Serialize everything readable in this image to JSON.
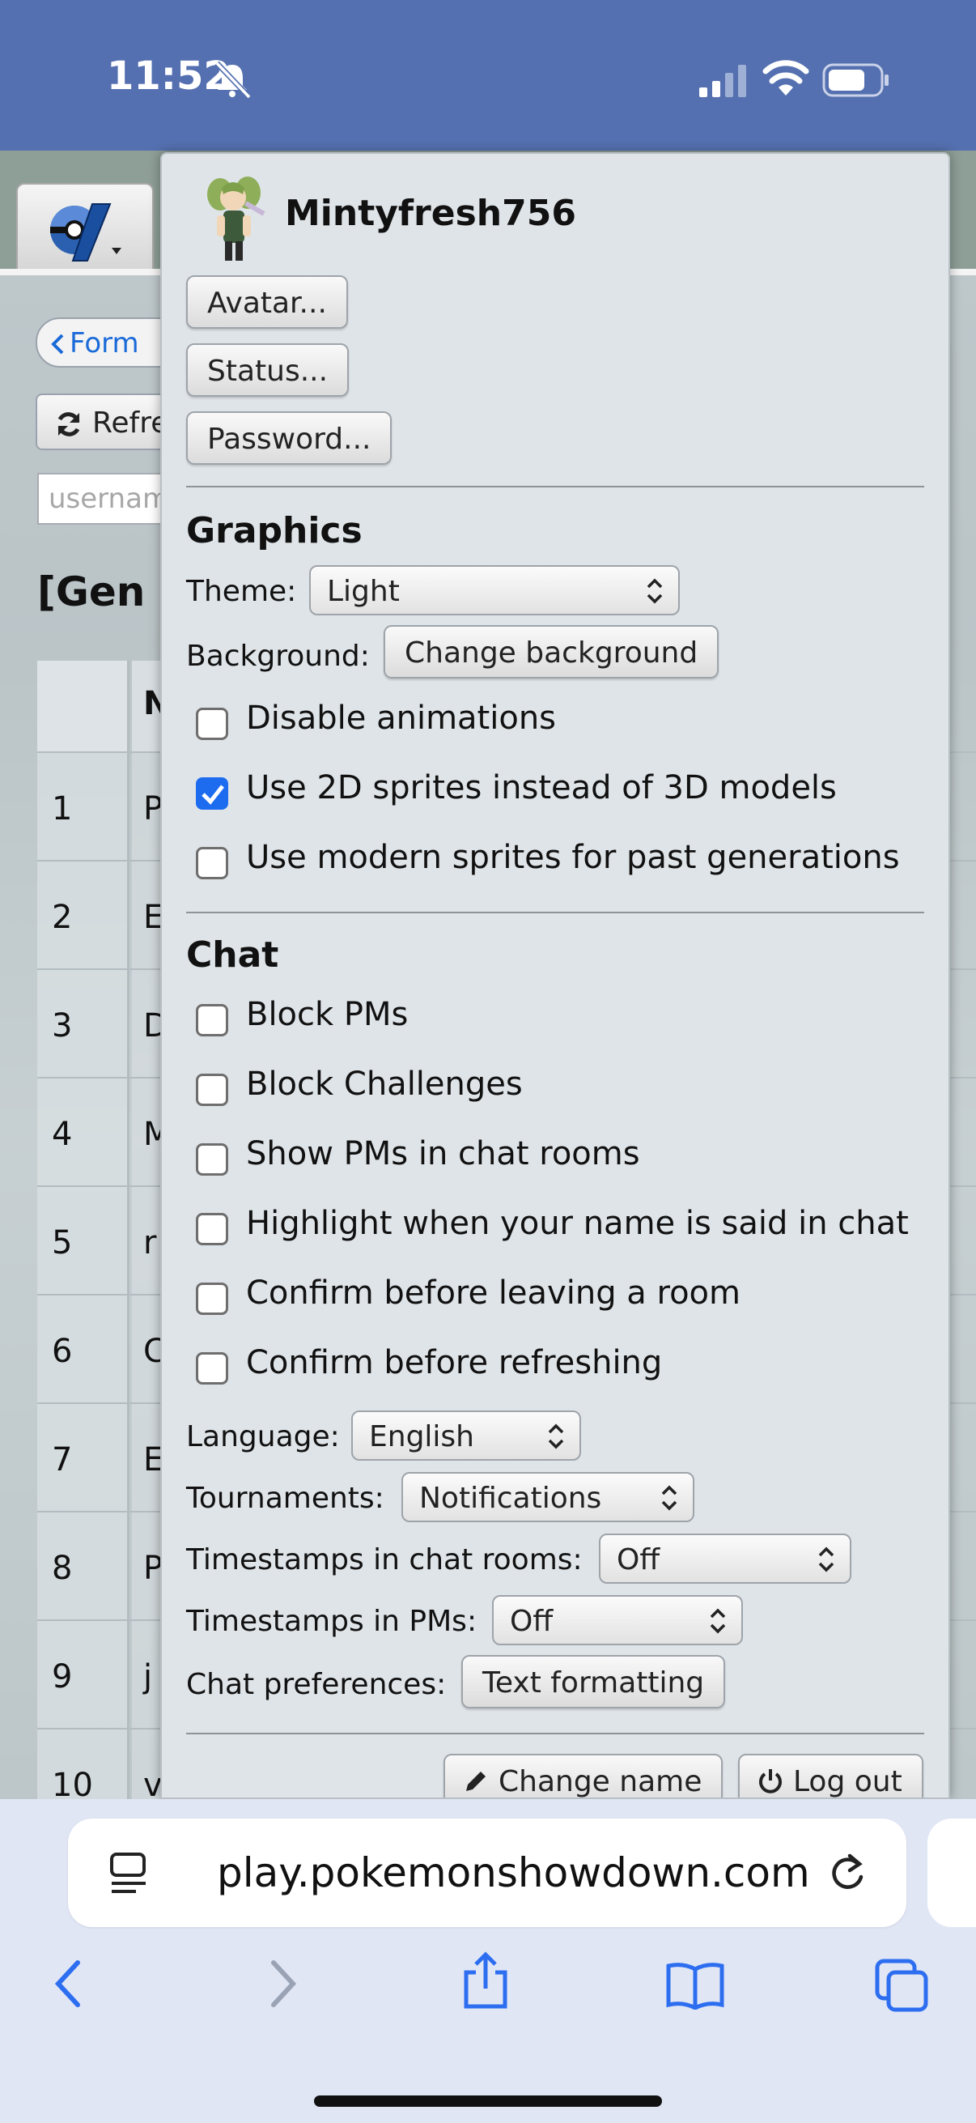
{
  "status": {
    "time": "11:52"
  },
  "page": {
    "back_pill": "Form",
    "refresh_button": "Refre",
    "username_placeholder": "usernam",
    "title": "[Gen",
    "header_col": "N",
    "rows": [
      {
        "num": "1",
        "name": "P"
      },
      {
        "num": "2",
        "name": "E"
      },
      {
        "num": "3",
        "name": "D"
      },
      {
        "num": "4",
        "name": "M"
      },
      {
        "num": "5",
        "name": "r"
      },
      {
        "num": "6",
        "name": "C"
      },
      {
        "num": "7",
        "name": "E"
      },
      {
        "num": "8",
        "name": "P"
      },
      {
        "num": "9",
        "name": "j"
      },
      {
        "num": "10",
        "name": "v"
      }
    ]
  },
  "popup": {
    "username": "Mintyfresh756",
    "avatar_button": "Avatar...",
    "status_button": "Status...",
    "password_button": "Password...",
    "graphics": {
      "heading": "Graphics",
      "theme_label": "Theme:",
      "theme_value": "Light",
      "background_label": "Background:",
      "background_button": "Change background",
      "options": [
        {
          "label": "Disable animations",
          "checked": false
        },
        {
          "label": "Use 2D sprites instead of 3D models",
          "checked": true
        },
        {
          "label": "Use modern sprites for past generations",
          "checked": false
        }
      ]
    },
    "chat": {
      "heading": "Chat",
      "options": [
        {
          "label": "Block PMs",
          "checked": false
        },
        {
          "label": "Block Challenges",
          "checked": false
        },
        {
          "label": "Show PMs in chat rooms",
          "checked": false
        },
        {
          "label": "Highlight when your name is said in chat",
          "checked": false
        },
        {
          "label": "Confirm before leaving a room",
          "checked": false
        },
        {
          "label": "Confirm before refreshing",
          "checked": false
        }
      ],
      "language_label": "Language:",
      "language_value": "English",
      "tournaments_label": "Tournaments:",
      "tournaments_value": "Notifications",
      "timestamps_rooms_label": "Timestamps in chat rooms:",
      "timestamps_rooms_value": "Off",
      "timestamps_pms_label": "Timestamps in PMs:",
      "timestamps_pms_value": "Off",
      "chat_prefs_label": "Chat preferences:",
      "chat_prefs_button": "Text formatting"
    },
    "change_name_button": "Change name",
    "logout_button": "Log out"
  },
  "browser": {
    "url": "play.pokemonshowdown.com"
  },
  "colors": {
    "status_bar": "#5570b0",
    "checkbox_checked": "#1d6cf0",
    "link_blue": "#1a6ad8"
  }
}
